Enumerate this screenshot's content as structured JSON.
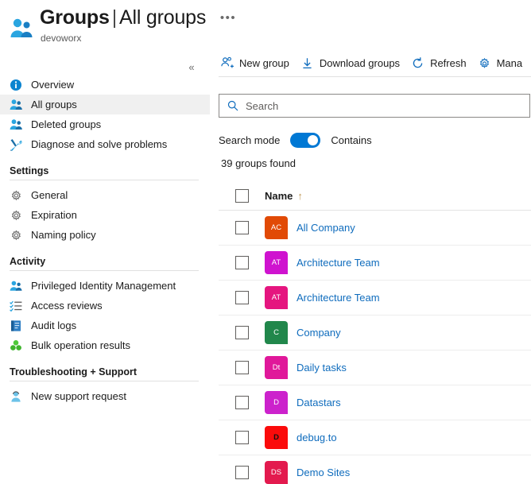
{
  "header": {
    "title_main": "Groups",
    "separator": "|",
    "title_sub": "All groups",
    "subtitle": "devoworx",
    "ellipsis": "•••",
    "icon": "groups-icon"
  },
  "sidebar": {
    "collapse_icon": "«",
    "items": [
      {
        "label": "Overview",
        "icon": "info-icon",
        "selected": false
      },
      {
        "label": "All groups",
        "icon": "groups-icon",
        "selected": true
      },
      {
        "label": "Deleted groups",
        "icon": "groups-icon",
        "selected": false
      },
      {
        "label": "Diagnose and solve problems",
        "icon": "wrench-icon",
        "selected": false
      }
    ],
    "groups": [
      {
        "title": "Settings",
        "items": [
          {
            "label": "General",
            "icon": "gear-icon"
          },
          {
            "label": "Expiration",
            "icon": "gear-icon"
          },
          {
            "label": "Naming policy",
            "icon": "gear-icon"
          }
        ]
      },
      {
        "title": "Activity",
        "items": [
          {
            "label": "Privileged Identity Management",
            "icon": "people-shield-icon"
          },
          {
            "label": "Access reviews",
            "icon": "checklist-icon"
          },
          {
            "label": "Audit logs",
            "icon": "book-icon"
          },
          {
            "label": "Bulk operation results",
            "icon": "clover-icon"
          }
        ]
      },
      {
        "title": "Troubleshooting + Support",
        "items": [
          {
            "label": "New support request",
            "icon": "support-person-icon"
          }
        ]
      }
    ]
  },
  "toolbar": {
    "buttons": [
      {
        "label": "New group",
        "icon": "new-group-icon"
      },
      {
        "label": "Download groups",
        "icon": "download-icon"
      },
      {
        "label": "Refresh",
        "icon": "refresh-icon"
      },
      {
        "label": "Mana",
        "icon": "gear-icon"
      }
    ]
  },
  "search": {
    "placeholder": "Search",
    "value": "",
    "icon": "search-icon",
    "mode_label": "Search mode",
    "mode_value": "Contains",
    "mode_on": true
  },
  "results": {
    "count_text": "39 groups found",
    "column_header": "Name",
    "sort_arrow": "↑",
    "rows": [
      {
        "initials": "AC",
        "name": "All Company",
        "color": "#e14a06",
        "text_color": "#ffffff"
      },
      {
        "initials": "AT",
        "name": "Architecture Team",
        "color": "#cf13cf",
        "text_color": "#ffffff"
      },
      {
        "initials": "AT",
        "name": "Architecture Team",
        "color": "#e5157f",
        "text_color": "#ffffff"
      },
      {
        "initials": "C",
        "name": "Company",
        "color": "#21874b",
        "text_color": "#ffffff"
      },
      {
        "initials": "Dt",
        "name": "Daily tasks",
        "color": "#e0189a",
        "text_color": "#ffffff"
      },
      {
        "initials": "D",
        "name": "Datastars",
        "color": "#cc22cc",
        "text_color": "#ffffff"
      },
      {
        "initials": "D",
        "name": "debug.to",
        "color": "#fb0b0b",
        "text_color": "#111111"
      },
      {
        "initials": "DS",
        "name": "Demo Sites",
        "color": "#e31a4e",
        "text_color": "#ffffff"
      }
    ]
  },
  "colors": {
    "accent": "#0078d4",
    "link": "#0f6cbd",
    "selected_row": "#f0f0f0"
  }
}
